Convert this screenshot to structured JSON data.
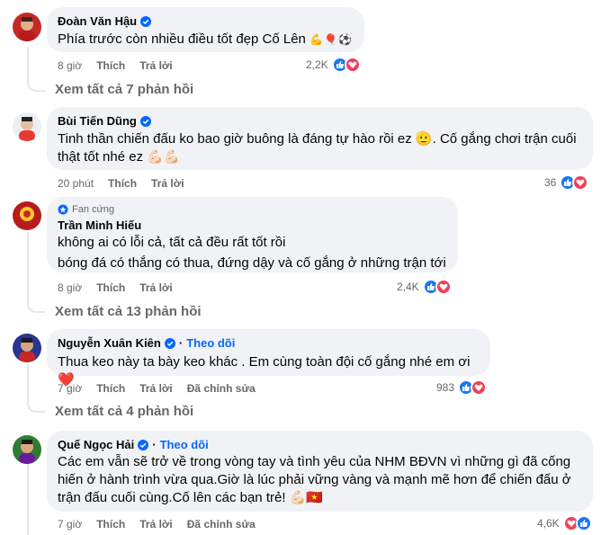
{
  "colors": {
    "accent": "#0866ff",
    "bubble": "#f0f2f5",
    "muted": "#65676b",
    "like": "#1877f2",
    "heart": "#f33e58"
  },
  "actions": {
    "like": "Thích",
    "reply": "Trả lời",
    "edited": "Đã chỉnh sửa"
  },
  "comments": [
    {
      "author": "Đoàn Văn Hậu",
      "verified": true,
      "text": "Phía trước còn nhiều điều tốt đẹp Cố Lên",
      "emoji": "💪🎈⚽",
      "time": "8 giờ",
      "reactions": "2,2K",
      "view_replies": "Xem tất cả 7 phản hồi"
    },
    {
      "author": "Bùi Tiến Dũng",
      "verified": true,
      "text": "Tinh thần chiến đấu ko bao giờ buông là đáng tự hào rồi ez 🫡. Cố gắng chơi trận cuối thật tốt nhé ez 💪🏻💪🏻",
      "time": "20 phút",
      "reactions": "36"
    },
    {
      "badge": "Fan cứng",
      "author": "Trần Minh Hiếu",
      "text_line1": "không ai có lỗi cả, tất cả đều rất tốt rồi",
      "text_line2": "bóng đá có thắng có thua, đứng dậy và cố gắng ở những trận tới",
      "time": "8 giờ",
      "reactions": "2,4K",
      "view_replies": "Xem tất cả 13 phản hồi"
    },
    {
      "author": "Nguyễn Xuân Kiên",
      "verified": true,
      "follow": "Theo dõi",
      "text": "Thua keo này ta bày keo khác . Em cùng toàn đội cố gắng nhé em ơi❤️",
      "time": "7 giờ",
      "edited": true,
      "reactions": "983",
      "view_replies": "Xem tất cả 4 phản hồi"
    },
    {
      "author": "Quế Ngọc Hải",
      "verified": true,
      "follow": "Theo dõi",
      "text": "Các em vẫn sẽ trở về trong vòng tay và tình yêu của NHM BĐVN vì những gì đã cống hiến ở hành trình vừa qua.Giờ là lúc phải vững vàng và mạnh mẽ hơn để chiến đấu ở trận đấu cuối cùng.Cố lên các bạn trẻ! 💪🏻🇻🇳",
      "time": "7 giờ",
      "edited": true,
      "reactions": "4,6K"
    }
  ]
}
